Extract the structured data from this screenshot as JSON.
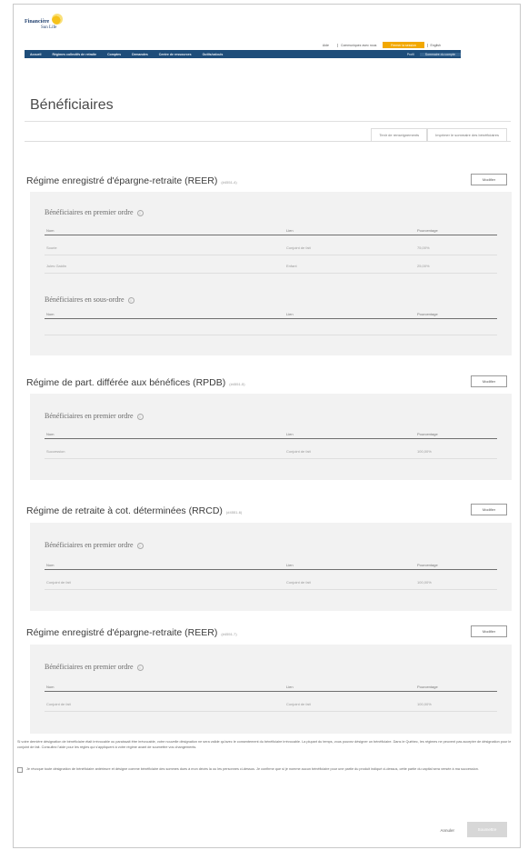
{
  "brand": {
    "line1": "Financière",
    "line2": "Sun Life",
    "accent": "#f2a800",
    "nav_color": "#1e4d7a"
  },
  "utility_links": [
    "Aide",
    "Communiquez avec nous",
    "Mon espace sécurisé",
    "English"
  ],
  "header_button": "Fermer la session",
  "nav": {
    "items": [
      "Accueil",
      "Régimes collectifs de retraite",
      "Comptes",
      "Demandes",
      "Centre de ressources",
      "Outils/calculs"
    ],
    "right_items": [
      "Profil",
      "Sommaire du compte"
    ]
  },
  "page_title": "Bénéficiaires",
  "tabs": [
    "Tenir de renseignements",
    "Imprimer le sommaire des bénéficiaires"
  ],
  "columns": {
    "name": "Nom",
    "relation": "Lien",
    "percent": "Pourcentage"
  },
  "modify_label": "Modifier",
  "sections": [
    {
      "title": "Régime enregistré d'épargne-retraite (REER)",
      "account": "(#4551-4)",
      "primary_title": "Bénéficiaires en premier ordre",
      "primary_rows": [
        {
          "name": "Sourie",
          "relation": "Conjoint de fait",
          "percent": "75,00%"
        },
        {
          "name": "Jules Gaidin",
          "relation": "Enfant",
          "percent": "25,00%"
        }
      ],
      "contingent_title": "Bénéficiaires en sous-ordre",
      "contingent_rows": []
    },
    {
      "title": "Régime de part. différée aux bénéfices (RPDB)",
      "account": "(#4551-5)",
      "primary_title": "Bénéficiaires en premier ordre",
      "primary_rows": [
        {
          "name": "Succession",
          "relation": "Conjoint de fait",
          "percent": "100,00%"
        }
      ]
    },
    {
      "title": "Régime de retraite à cot. déterminées (RRCD)",
      "account": "(#4551-6)",
      "primary_title": "Bénéficiaires en premier ordre",
      "primary_rows": [
        {
          "name": "Conjoint de fait",
          "relation": "Conjoint de fait",
          "percent": "100,00%"
        }
      ]
    },
    {
      "title": "Régime enregistré d'épargne-retraite (REER)",
      "account": "(#4551-7)",
      "primary_title": "Bénéficiaires en premier ordre",
      "primary_rows": [
        {
          "name": "Conjoint de fait",
          "relation": "Conjoint de fait",
          "percent": "100,00%"
        }
      ]
    }
  ],
  "disclaimer": "Si votre dernière désignation de bénéficiaire était irrévocable ou paraissait être irrévocable, votre nouvelle désignation ne sera valide qu'avec le consentement du bénéficiaire irrévocable. La plupart du temps, vous pouvez désigner un bénéficiaire. Dans le Québec, les régimes ne peuvent pas accepter de désignation pour le conjoint de fait. Consultez l'aide pour les règles qui s'appliquent à votre régime avant de soumettre vos changements.",
  "confirm_text": "Je révoque toute désignation de bénéficiaire antérieure et désigne comme bénéficiaire des sommes dues à mon décès la ou les personnes ci-dessus. Je confirme que si je nomme aucun bénéficiaire pour une partie du produit indiqué ci-dessus, cette partie du capital sera versée à ma succession.",
  "cancel_label": "Annuler",
  "submit_label": "Soumettre"
}
